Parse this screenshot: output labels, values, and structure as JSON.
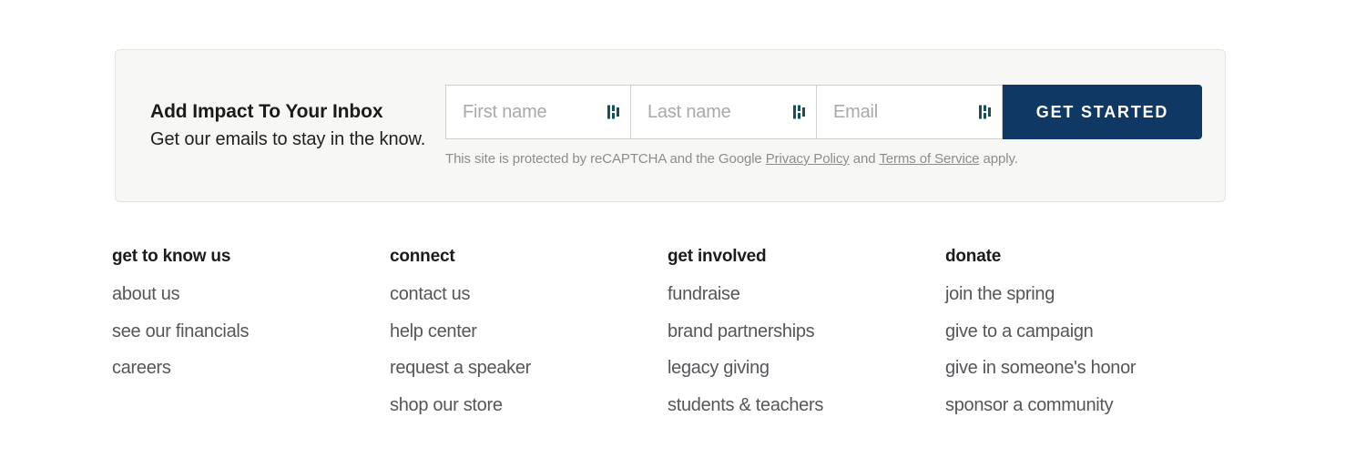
{
  "signup": {
    "title": "Add Impact To Your Inbox",
    "subtitle": "Get our emails to stay in the know.",
    "fields": [
      {
        "name": "first-name",
        "placeholder": "First name",
        "value": "",
        "icon": "autofill-icon"
      },
      {
        "name": "last-name",
        "placeholder": "Last name",
        "value": "",
        "icon": "autofill-icon"
      },
      {
        "name": "email",
        "placeholder": "Email",
        "value": "",
        "icon": "autofill-icon"
      }
    ],
    "submit_label": "GET STARTED",
    "submit_color": "#103864",
    "recaptcha": {
      "lead": "This site is protected by reCAPTCHA and the Google ",
      "privacy_link": "Privacy Policy",
      "middle": " and ",
      "terms_link": "Terms of Service",
      "tail": " apply."
    },
    "card_bg": "#f7f7f5",
    "card_border": "#e4e3de"
  },
  "footer": {
    "columns": [
      {
        "heading": "get to know us",
        "links": [
          "about us",
          "see our financials",
          "careers"
        ]
      },
      {
        "heading": "connect",
        "links": [
          "contact us",
          "help center",
          "request a speaker",
          "shop our store"
        ]
      },
      {
        "heading": "get involved",
        "links": [
          "fundraise",
          "brand partnerships",
          "legacy giving",
          "students & teachers"
        ]
      },
      {
        "heading": "donate",
        "links": [
          "join the spring",
          "give to a campaign",
          "give in someone's honor",
          "sponsor a community"
        ]
      }
    ],
    "heading_color": "#1b1b1b",
    "link_color": "#55565a"
  }
}
